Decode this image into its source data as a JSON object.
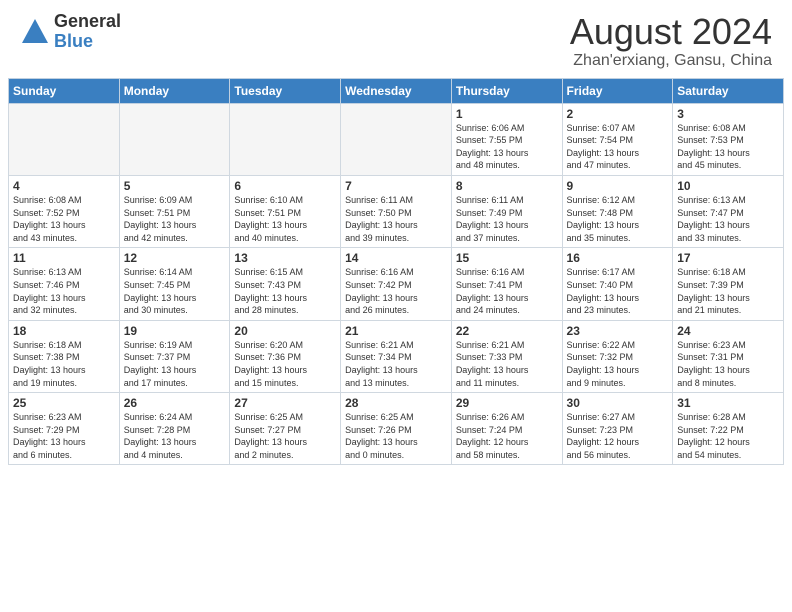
{
  "header": {
    "logo_general": "General",
    "logo_blue": "Blue",
    "month_year": "August 2024",
    "location": "Zhan'erxiang, Gansu, China"
  },
  "weekdays": [
    "Sunday",
    "Monday",
    "Tuesday",
    "Wednesday",
    "Thursday",
    "Friday",
    "Saturday"
  ],
  "weeks": [
    [
      {
        "num": "",
        "info": ""
      },
      {
        "num": "",
        "info": ""
      },
      {
        "num": "",
        "info": ""
      },
      {
        "num": "",
        "info": ""
      },
      {
        "num": "1",
        "info": "Sunrise: 6:06 AM\nSunset: 7:55 PM\nDaylight: 13 hours\nand 48 minutes."
      },
      {
        "num": "2",
        "info": "Sunrise: 6:07 AM\nSunset: 7:54 PM\nDaylight: 13 hours\nand 47 minutes."
      },
      {
        "num": "3",
        "info": "Sunrise: 6:08 AM\nSunset: 7:53 PM\nDaylight: 13 hours\nand 45 minutes."
      }
    ],
    [
      {
        "num": "4",
        "info": "Sunrise: 6:08 AM\nSunset: 7:52 PM\nDaylight: 13 hours\nand 43 minutes."
      },
      {
        "num": "5",
        "info": "Sunrise: 6:09 AM\nSunset: 7:51 PM\nDaylight: 13 hours\nand 42 minutes."
      },
      {
        "num": "6",
        "info": "Sunrise: 6:10 AM\nSunset: 7:51 PM\nDaylight: 13 hours\nand 40 minutes."
      },
      {
        "num": "7",
        "info": "Sunrise: 6:11 AM\nSunset: 7:50 PM\nDaylight: 13 hours\nand 39 minutes."
      },
      {
        "num": "8",
        "info": "Sunrise: 6:11 AM\nSunset: 7:49 PM\nDaylight: 13 hours\nand 37 minutes."
      },
      {
        "num": "9",
        "info": "Sunrise: 6:12 AM\nSunset: 7:48 PM\nDaylight: 13 hours\nand 35 minutes."
      },
      {
        "num": "10",
        "info": "Sunrise: 6:13 AM\nSunset: 7:47 PM\nDaylight: 13 hours\nand 33 minutes."
      }
    ],
    [
      {
        "num": "11",
        "info": "Sunrise: 6:13 AM\nSunset: 7:46 PM\nDaylight: 13 hours\nand 32 minutes."
      },
      {
        "num": "12",
        "info": "Sunrise: 6:14 AM\nSunset: 7:45 PM\nDaylight: 13 hours\nand 30 minutes."
      },
      {
        "num": "13",
        "info": "Sunrise: 6:15 AM\nSunset: 7:43 PM\nDaylight: 13 hours\nand 28 minutes."
      },
      {
        "num": "14",
        "info": "Sunrise: 6:16 AM\nSunset: 7:42 PM\nDaylight: 13 hours\nand 26 minutes."
      },
      {
        "num": "15",
        "info": "Sunrise: 6:16 AM\nSunset: 7:41 PM\nDaylight: 13 hours\nand 24 minutes."
      },
      {
        "num": "16",
        "info": "Sunrise: 6:17 AM\nSunset: 7:40 PM\nDaylight: 13 hours\nand 23 minutes."
      },
      {
        "num": "17",
        "info": "Sunrise: 6:18 AM\nSunset: 7:39 PM\nDaylight: 13 hours\nand 21 minutes."
      }
    ],
    [
      {
        "num": "18",
        "info": "Sunrise: 6:18 AM\nSunset: 7:38 PM\nDaylight: 13 hours\nand 19 minutes."
      },
      {
        "num": "19",
        "info": "Sunrise: 6:19 AM\nSunset: 7:37 PM\nDaylight: 13 hours\nand 17 minutes."
      },
      {
        "num": "20",
        "info": "Sunrise: 6:20 AM\nSunset: 7:36 PM\nDaylight: 13 hours\nand 15 minutes."
      },
      {
        "num": "21",
        "info": "Sunrise: 6:21 AM\nSunset: 7:34 PM\nDaylight: 13 hours\nand 13 minutes."
      },
      {
        "num": "22",
        "info": "Sunrise: 6:21 AM\nSunset: 7:33 PM\nDaylight: 13 hours\nand 11 minutes."
      },
      {
        "num": "23",
        "info": "Sunrise: 6:22 AM\nSunset: 7:32 PM\nDaylight: 13 hours\nand 9 minutes."
      },
      {
        "num": "24",
        "info": "Sunrise: 6:23 AM\nSunset: 7:31 PM\nDaylight: 13 hours\nand 8 minutes."
      }
    ],
    [
      {
        "num": "25",
        "info": "Sunrise: 6:23 AM\nSunset: 7:29 PM\nDaylight: 13 hours\nand 6 minutes."
      },
      {
        "num": "26",
        "info": "Sunrise: 6:24 AM\nSunset: 7:28 PM\nDaylight: 13 hours\nand 4 minutes."
      },
      {
        "num": "27",
        "info": "Sunrise: 6:25 AM\nSunset: 7:27 PM\nDaylight: 13 hours\nand 2 minutes."
      },
      {
        "num": "28",
        "info": "Sunrise: 6:25 AM\nSunset: 7:26 PM\nDaylight: 13 hours\nand 0 minutes."
      },
      {
        "num": "29",
        "info": "Sunrise: 6:26 AM\nSunset: 7:24 PM\nDaylight: 12 hours\nand 58 minutes."
      },
      {
        "num": "30",
        "info": "Sunrise: 6:27 AM\nSunset: 7:23 PM\nDaylight: 12 hours\nand 56 minutes."
      },
      {
        "num": "31",
        "info": "Sunrise: 6:28 AM\nSunset: 7:22 PM\nDaylight: 12 hours\nand 54 minutes."
      }
    ]
  ]
}
